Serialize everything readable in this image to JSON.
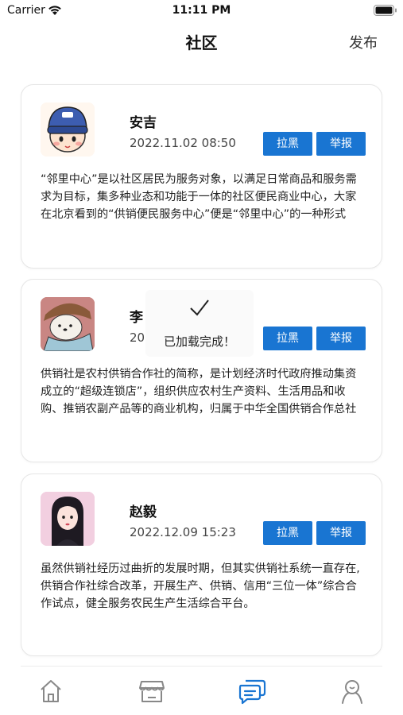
{
  "status_bar": {
    "carrier": "Carrier",
    "time": "11:11 PM"
  },
  "nav": {
    "title": "社区",
    "publish_label": "发布"
  },
  "posts": [
    {
      "name": "安吉",
      "time": "2022.11.02 08:50",
      "block_label": "拉黑",
      "report_label": "举报",
      "content": "“邻里中心”是以社区居民为服务对象，以满足日常商品和服务需求为目标，集多种业态和功能于一体的社区便民商业中心，大家在北京看到的“供销便民服务中心”便是“邻里中心”的一种形式"
    },
    {
      "name": "李",
      "time": "20",
      "block_label": "拉黑",
      "report_label": "举报",
      "content": "供销社是农村供销合作社的简称，是计划经济时代政府推动集资成立的“超级连锁店”，组织供应农村生产资料、生活用品和收购、推销农副产品等的商业机构，归属于中华全国供销合作总社"
    },
    {
      "name": "赵毅",
      "time": "2022.12.09 15:23",
      "block_label": "拉黑",
      "report_label": "举报",
      "content": "虽然供销社经历过曲折的发展时期，但其实供销社系统一直存在,供销合作社综合改革，开展生产、供销、信用“三位一体”综合合作试点，健全服务农民生产生活综合平台。"
    }
  ],
  "toast": {
    "text": "已加载完成！"
  },
  "tabbar": {
    "active_color": "#1975d2",
    "inactive_color": "#888888",
    "items": [
      {
        "icon": "home-icon",
        "active": false
      },
      {
        "icon": "store-icon",
        "active": false
      },
      {
        "icon": "community-chat-icon",
        "active": true
      },
      {
        "icon": "profile-icon",
        "active": false
      }
    ]
  },
  "colors": {
    "button_blue": "#1975d2"
  }
}
